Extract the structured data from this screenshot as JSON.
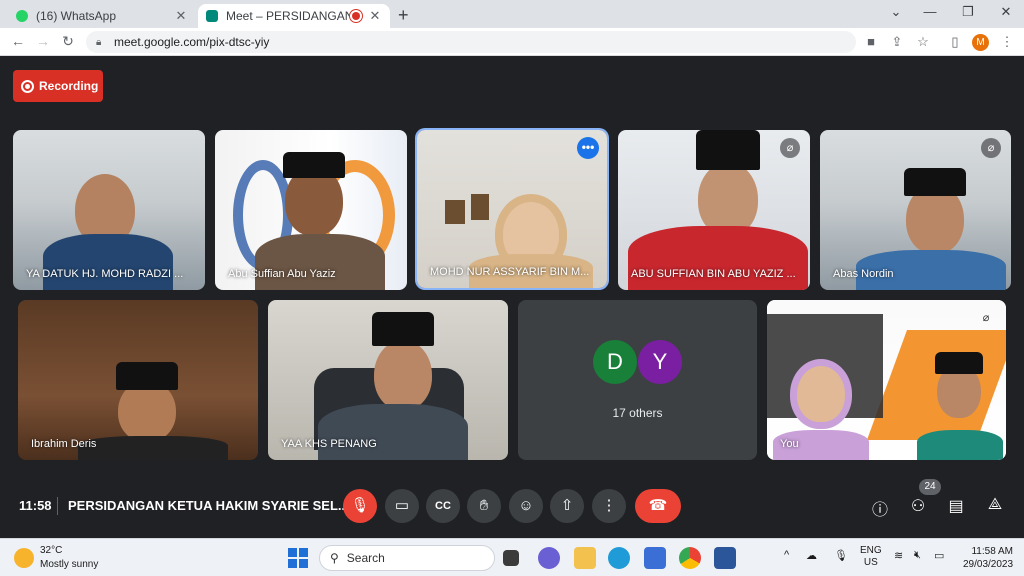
{
  "browser": {
    "tabs": [
      {
        "title": "(16) WhatsApp",
        "favicon_color": "#25d366"
      },
      {
        "title": "Meet – PERSIDANGAN KETUA",
        "favicon_color": "#00897b"
      }
    ],
    "url": "meet.google.com/pix-dtsc-yiy",
    "profile_initial": "M"
  },
  "meet": {
    "recording_label": "Recording",
    "participants": [
      {
        "name": "YA DATUK HJ. MOHD RADZI ..."
      },
      {
        "name": "Abu Suffian Abu Yaziz"
      },
      {
        "name": "MOHD NUR ASSYARIF BIN M..."
      },
      {
        "name": "ABU SUFFIAN BIN ABU YAZIZ ..."
      },
      {
        "name": "Abas Nordin"
      },
      {
        "name": "Ibrahim Deris"
      },
      {
        "name": "YAA KHS PENANG"
      },
      {
        "name": "You"
      }
    ],
    "others": {
      "avatars": [
        {
          "letter": "D",
          "color": "#188038"
        },
        {
          "letter": "Y",
          "color": "#7b1fa2"
        }
      ],
      "label": "17 others"
    },
    "bottom": {
      "time": "11:58",
      "title": "PERSIDANGAN KETUA HAKIM SYARIE SEL...",
      "people_count": "24"
    }
  },
  "taskbar": {
    "weather_temp": "32°C",
    "weather_desc": "Mostly sunny",
    "search_placeholder": "Search",
    "lang_top": "ENG",
    "lang_bottom": "US",
    "time": "11:58 AM",
    "date": "29/03/2023"
  }
}
